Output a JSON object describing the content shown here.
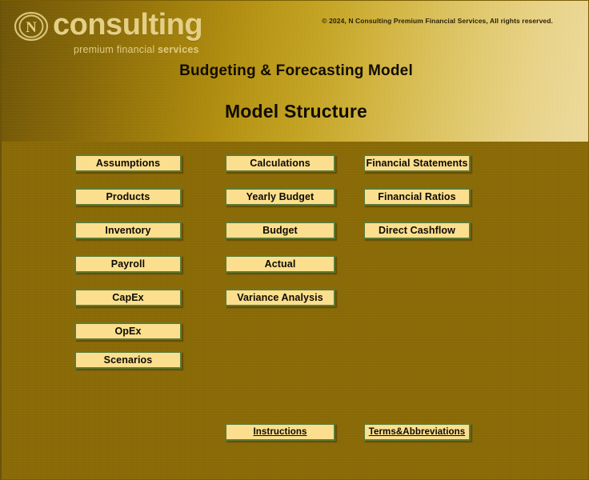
{
  "brand": {
    "logo_icon": "circled-n-logo-icon",
    "wordmark": "consulting",
    "tagline_light": "premium financial ",
    "tagline_bold": "services",
    "wordmark_color": "#e4cf86"
  },
  "header": {
    "copyright": "© 2024, N Consulting Premium Financial Services, All rights reserved.",
    "title": "Budgeting & Forecasting  Model",
    "subtitle": "Model Structure",
    "band_gradient_from": "#6e5405",
    "band_gradient_to": "#f0dd9c"
  },
  "theme": {
    "page_background": "#8a6a06",
    "button_fill": "#fbdf8e",
    "button_border": "#5e7a36",
    "button_text": "#0e0a02",
    "title_text": "#120d02"
  },
  "navigation": {
    "column_inputs": [
      {
        "label": "Assumptions"
      },
      {
        "label": "Products"
      },
      {
        "label": "Inventory"
      },
      {
        "label": "Payroll"
      },
      {
        "label": "CapEx"
      },
      {
        "label": "OpEx"
      },
      {
        "label": "Scenarios"
      }
    ],
    "column_calculations": [
      {
        "label": "Calculations"
      },
      {
        "label": "Yearly  Budget"
      },
      {
        "label": "Budget"
      },
      {
        "label": "Actual"
      },
      {
        "label": "Variance Analysis"
      }
    ],
    "column_outputs": [
      {
        "label": "Financial Statements"
      },
      {
        "label": "Financial Ratios"
      },
      {
        "label": "Direct Cashflow"
      }
    ],
    "footer_links": [
      {
        "label": "Instructions"
      },
      {
        "label": "Terms&Abbreviations"
      }
    ]
  }
}
